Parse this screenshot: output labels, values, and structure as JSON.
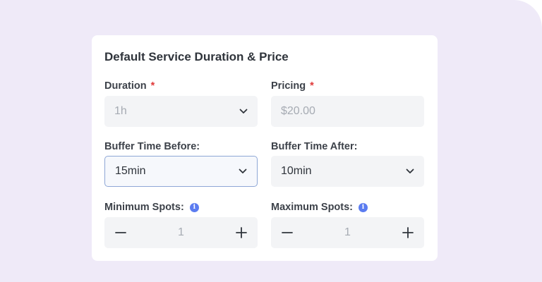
{
  "card_title": "Default Service Duration & Price",
  "duration": {
    "label": "Duration",
    "required_mark": "*",
    "value": "1h"
  },
  "pricing": {
    "label": "Pricing",
    "required_mark": "*",
    "value": "$20.00"
  },
  "buffer_before": {
    "label": "Buffer Time Before:",
    "value": "15min"
  },
  "buffer_after": {
    "label": "Buffer Time After:",
    "value": "10min"
  },
  "min_spots": {
    "label": "Minimum Spots:",
    "info_glyph": "i",
    "value": "1",
    "decrement": "−",
    "increment": "+"
  },
  "max_spots": {
    "label": "Maximum Spots:",
    "info_glyph": "i",
    "value": "1",
    "decrement": "−",
    "increment": "+"
  },
  "colors": {
    "background": "#efeaf8",
    "required": "#e03a3a",
    "info": "#5b7cf0",
    "focus_border": "#8ea7d6"
  }
}
